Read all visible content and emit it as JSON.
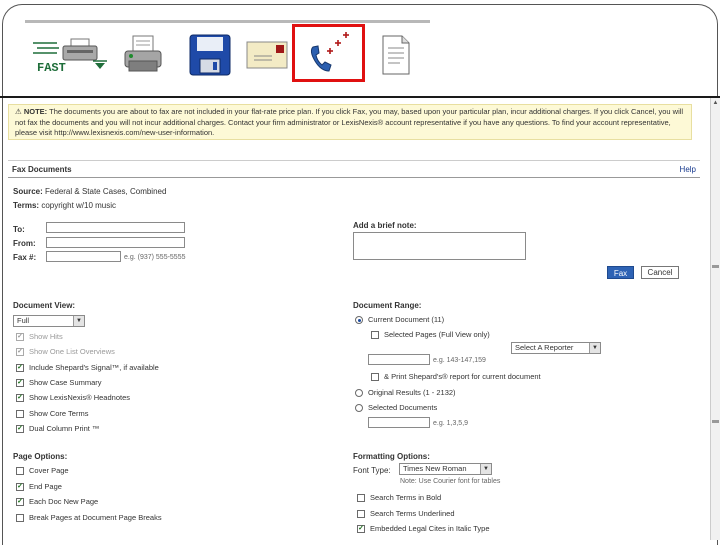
{
  "toolbar": {
    "fast_label": "FAST",
    "items": [
      "fast-print-icon",
      "print-icon",
      "save-disk-icon",
      "email-icon",
      "fax-icon",
      "document-icon"
    ],
    "highlight_color": "#e01010"
  },
  "note": {
    "label": "NOTE:",
    "text": "The documents you are about to fax are not included in your flat-rate price plan. If you click Fax, you may, based upon your particular plan, incur additional charges. If you click Cancel, you will not fax the documents and you will not incur additional charges. Contact your firm administrator or LexisNexis® account representative if you have any questions. To find your account representative, please visit http://www.lexisnexis.com/new-user-information."
  },
  "panel": {
    "title": "Fax Documents",
    "help": "Help"
  },
  "source": {
    "source_label": "Source:",
    "source_value": "Federal & State Cases, Combined",
    "terms_label": "Terms:",
    "terms_value": "copyright w/10 music"
  },
  "fax_form": {
    "to_label": "To:",
    "from_label": "From:",
    "fax_label": "Fax #:",
    "fax_hint": "e.g. (937) 555-5555",
    "note_label": "Add a brief note:",
    "fax_button": "Fax",
    "cancel_button": "Cancel"
  },
  "document_view": {
    "label": "Document View:",
    "selected": "Full",
    "options": [
      {
        "label": "Show Hits",
        "checked": true,
        "disabled": true
      },
      {
        "label": "Show One List Overviews",
        "checked": true,
        "disabled": true
      },
      {
        "label": "Include Shepard's Signal™, if available",
        "checked": true,
        "disabled": false
      },
      {
        "label": "Show Case Summary",
        "checked": true,
        "disabled": false
      },
      {
        "label": "Show LexisNexis® Headnotes",
        "checked": true,
        "disabled": false
      },
      {
        "label": "Show Core Terms",
        "checked": false,
        "disabled": false
      },
      {
        "label": "Dual Column Print ™",
        "checked": true,
        "disabled": false
      }
    ]
  },
  "document_range": {
    "label": "Document Range:",
    "current_doc": "Current Document (11)",
    "selected_pages": "Selected Pages (Full View only)",
    "select_reporter": "Select A Reporter",
    "pages_hint": "e.g. 143-147,159",
    "shepards_report": "& Print Shepard's® report for current document",
    "original_results": "Original Results (1 - 2132)",
    "selected_docs": "Selected Documents",
    "docs_hint": "e.g. 1,3,5,9"
  },
  "page_options": {
    "label": "Page Options:",
    "options": [
      {
        "label": "Cover Page",
        "checked": false
      },
      {
        "label": "End Page",
        "checked": true
      },
      {
        "label": "Each Doc New Page",
        "checked": true
      },
      {
        "label": "Break Pages at Document Page Breaks",
        "checked": false
      }
    ]
  },
  "formatting": {
    "label": "Formatting Options:",
    "font_type_label": "Font Type:",
    "font_type_value": "Times New Roman",
    "font_note": "Note: Use Courier font for tables",
    "options": [
      {
        "label": "Search Terms in Bold",
        "checked": false
      },
      {
        "label": "Search Terms Underlined",
        "checked": false
      },
      {
        "label": "Embedded Legal Cites in Italic Type",
        "checked": true
      }
    ]
  }
}
